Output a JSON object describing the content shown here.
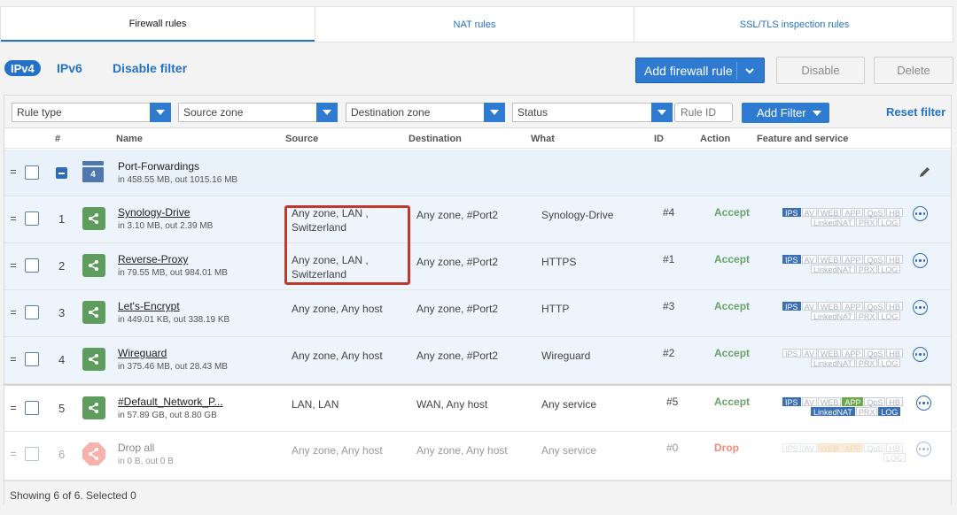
{
  "tabs": [
    "Firewall rules",
    "NAT rules",
    "SSL/TLS inspection rules"
  ],
  "toolbar": {
    "ipv4": "IPv4",
    "ipv6": "IPv6",
    "disable_filter": "Disable filter",
    "add_rule": "Add firewall rule",
    "disable": "Disable",
    "delete": "Delete"
  },
  "filters": {
    "rule_type": "Rule type",
    "source_zone": "Source zone",
    "destination_zone": "Destination zone",
    "status": "Status",
    "rule_id_placeholder": "Rule ID",
    "add_filter": "Add Filter",
    "reset_filter": "Reset filter"
  },
  "columns": [
    "#",
    "Name",
    "Source",
    "Destination",
    "What",
    "ID",
    "Action",
    "Feature and service"
  ],
  "group": {
    "name": "Port-Forwardings",
    "traffic": "in 458.55 MB, out 1015.16 MB",
    "icon_label": "4"
  },
  "rules": [
    {
      "num": "1",
      "name": "Synology-Drive",
      "traffic": "in 3.10 MB, out 2.39 MB",
      "source": "Any zone, LAN , Switzerland",
      "destination": "Any zone, #Port2",
      "what": "Synology-Drive",
      "id": "#4",
      "action": "Accept"
    },
    {
      "num": "2",
      "name": "Reverse-Proxy",
      "traffic": "in 79.55 MB, out 984.01 MB",
      "source": "Any zone, LAN , Switzerland",
      "destination": "Any zone, #Port2",
      "what": "HTTPS",
      "id": "#1",
      "action": "Accept"
    },
    {
      "num": "3",
      "name": "Let's-Encrypt",
      "traffic": "in 449.01 KB, out 338.19 KB",
      "source": "Any zone, Any host",
      "destination": "Any zone, #Port2",
      "what": "HTTP",
      "id": "#3",
      "action": "Accept"
    },
    {
      "num": "4",
      "name": "Wireguard",
      "traffic": "in 375.46 MB, out 28.43 MB",
      "source": "Any zone, Any host",
      "destination": "Any zone, #Port2",
      "what": "Wireguard",
      "id": "#2",
      "action": "Accept"
    },
    {
      "num": "5",
      "name": "#Default_Network_P...",
      "traffic": "in 57.89 GB, out 8.80 GB",
      "source": "LAN, LAN",
      "destination": "WAN, Any host",
      "what": "Any service",
      "id": "#5",
      "action": "Accept"
    },
    {
      "num": "6",
      "name": "Drop all",
      "traffic": "in 0 B, out 0 B",
      "source": "Any zone, Any host",
      "destination": "Any zone, Any host",
      "what": "Any service",
      "id": "#0",
      "action": "Drop"
    }
  ],
  "feature_labels": {
    "ips": "IPS",
    "av": "AV",
    "web": "WEB",
    "app": "APP",
    "qos": "QoS",
    "hb": "HB",
    "linkednat": "LinkedNAT",
    "prx": "PRX",
    "log": "LOG"
  },
  "footer": "Showing 6 of 6. Selected 0",
  "colors": {
    "accent": "#2472c8",
    "accept": "#6aa36a",
    "drop": "#f08a7a"
  }
}
